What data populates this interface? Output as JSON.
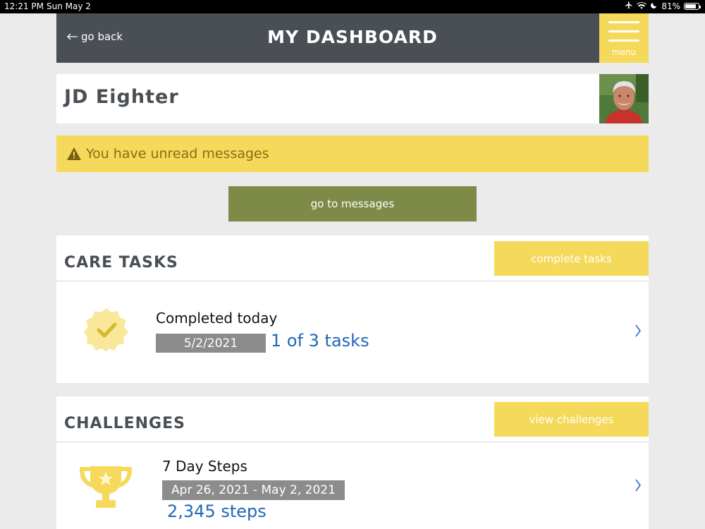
{
  "status_bar": {
    "time": "12:21 PM",
    "date": "Sun May 2",
    "battery": "81%",
    "battery_level": 0.81,
    "icons": [
      "airplane-icon",
      "wifi-icon",
      "moon-icon",
      "battery-icon"
    ]
  },
  "header": {
    "back_label": "go back",
    "title": "MY DASHBOARD",
    "menu_label": "menu"
  },
  "profile": {
    "name": "JD Eighter"
  },
  "alert": {
    "text": "You have unread messages"
  },
  "messages_button": {
    "label": "go to messages"
  },
  "care_tasks": {
    "title": "CARE TASKS",
    "action_label": "complete tasks",
    "item_title": "Completed today",
    "date": "5/2/2021",
    "count": "1 of 3 tasks"
  },
  "challenges": {
    "title": "CHALLENGES",
    "action_label": "view challenges",
    "item_title": "7 Day Steps",
    "date_range": "Apr 26, 2021 - May 2, 2021",
    "steps": "2,345 steps"
  },
  "colors": {
    "header": "#4a4f55",
    "accent_yellow": "#f5d95a",
    "olive_button": "#7e8b48",
    "link_blue": "#2366b8",
    "alert_text": "#8a6c14"
  }
}
